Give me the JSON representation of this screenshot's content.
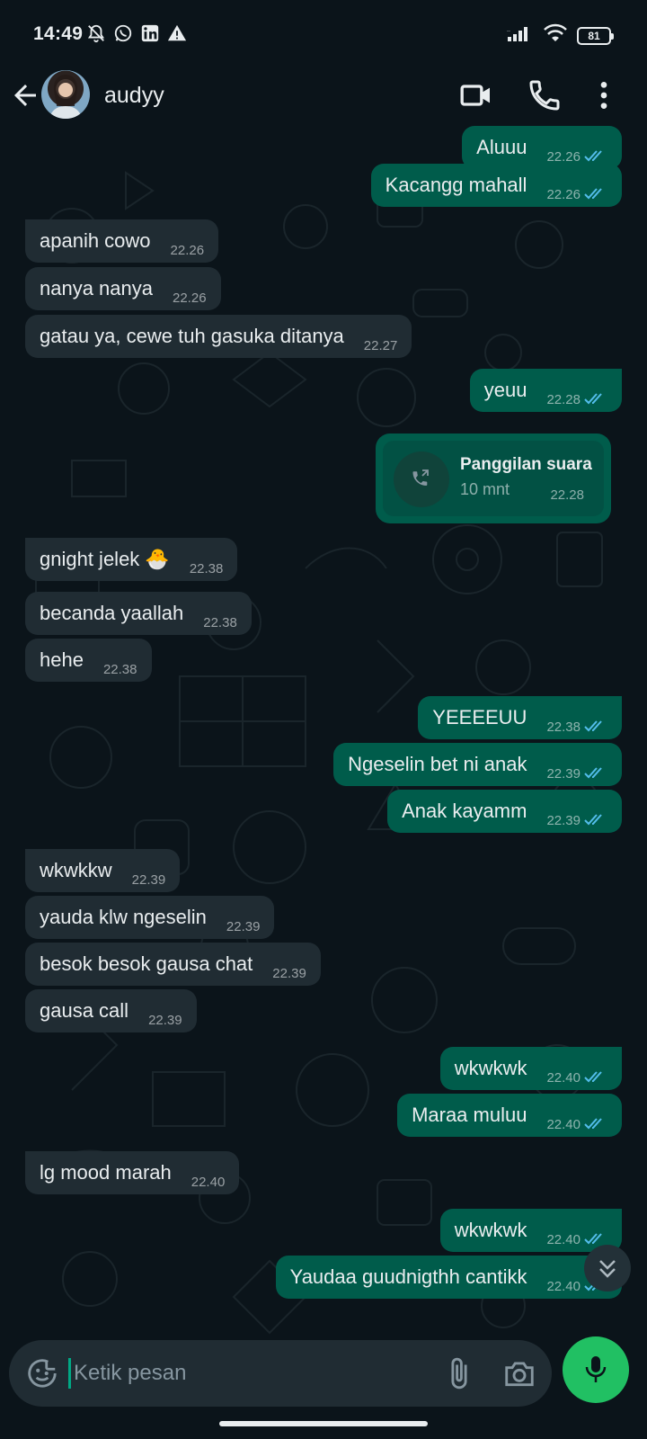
{
  "status_bar": {
    "time": "14:49",
    "battery": "81",
    "left_icons": [
      "mute-bell-icon",
      "whatsapp-icon",
      "linkedin-icon",
      "warning-icon"
    ],
    "right_icons": [
      "signal-icon",
      "wifi-icon",
      "battery-icon"
    ]
  },
  "header": {
    "contact_name": "audyy",
    "icons": [
      "back-arrow-icon",
      "avatar",
      "video-call-icon",
      "voice-call-icon",
      "more-vert-icon"
    ]
  },
  "messages": [
    {
      "dir": "out",
      "text": "Aluuu",
      "time": "22.26",
      "read": true
    },
    {
      "dir": "out",
      "text": "Kacangg mahall",
      "time": "22.26",
      "read": true
    },
    {
      "dir": "in",
      "text": "apanih cowo",
      "time": "22.26"
    },
    {
      "dir": "in",
      "text": "nanya nanya",
      "time": "22.26"
    },
    {
      "dir": "in",
      "text": "gatau ya, cewe tuh gasuka ditanya",
      "time": "22.27"
    },
    {
      "dir": "out",
      "text": "yeuu",
      "time": "22.28",
      "read": true
    },
    {
      "dir": "in",
      "text": "gnight jelek 🐣",
      "time": "22.38"
    },
    {
      "dir": "in",
      "text": "becanda yaallah",
      "time": "22.38"
    },
    {
      "dir": "in",
      "text": "hehe",
      "time": "22.38"
    },
    {
      "dir": "out",
      "text": "YEEEEUU",
      "time": "22.38",
      "read": true
    },
    {
      "dir": "out",
      "text": "Ngeselin bet ni anak",
      "time": "22.39",
      "read": true
    },
    {
      "dir": "out",
      "text": "Anak kayamm",
      "time": "22.39",
      "read": true
    },
    {
      "dir": "in",
      "text": "wkwkkw",
      "time": "22.39"
    },
    {
      "dir": "in",
      "text": "yauda klw ngeselin",
      "time": "22.39"
    },
    {
      "dir": "in",
      "text": "besok besok gausa chat",
      "time": "22.39"
    },
    {
      "dir": "in",
      "text": "gausa call",
      "time": "22.39"
    },
    {
      "dir": "out",
      "text": "wkwkwk",
      "time": "22.40",
      "read": true
    },
    {
      "dir": "out",
      "text": "Maraa muluu",
      "time": "22.40",
      "read": true
    },
    {
      "dir": "in",
      "text": "lg mood marah",
      "time": "22.40"
    },
    {
      "dir": "out",
      "text": "wkwkwk",
      "time": "22.40",
      "read": true
    },
    {
      "dir": "out",
      "text": "Yaudaa guudnigthh cantikk",
      "time": "22.40",
      "read": true
    }
  ],
  "call": {
    "title": "Panggilan suara",
    "duration": "10 mnt",
    "time": "22.28",
    "icon": "outgoing-call-icon"
  },
  "composer": {
    "placeholder": "Ketik pesan",
    "value": "",
    "icons": [
      "emoji-icon",
      "attach-icon",
      "camera-icon",
      "mic-icon"
    ]
  },
  "colors": {
    "background": "#0b141a",
    "incoming_bubble": "#202c33",
    "outgoing_bubble": "#005c4b",
    "read_ticks": "#53bdeb",
    "mic_button": "#21c063",
    "text": "#e9edef"
  }
}
